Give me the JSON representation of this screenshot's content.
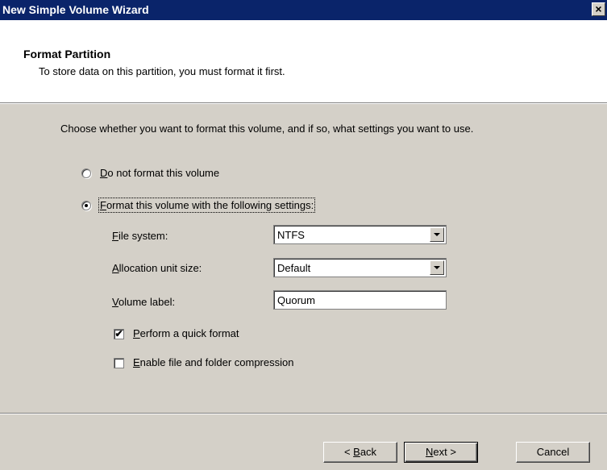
{
  "window": {
    "title": "New Simple Volume Wizard",
    "close_glyph": "×"
  },
  "header": {
    "title": "Format Partition",
    "subtitle": "To store data on this partition, you must format it first."
  },
  "body": {
    "intro": "Choose whether you want to format this volume, and if so, what settings you want to use.",
    "options": {
      "do_not_format": {
        "prefix_underlined": "D",
        "rest": "o not format this volume",
        "selected": false
      },
      "format": {
        "prefix_underlined": "F",
        "rest": "ormat this volume with the following settings:",
        "selected": true
      }
    },
    "file_system": {
      "label_u": "F",
      "label_rest": "ile system:",
      "value": "NTFS"
    },
    "allocation_unit": {
      "label_u": "A",
      "label_rest": "llocation unit size:",
      "value": "Default"
    },
    "volume_label": {
      "label_u": "V",
      "label_rest": "olume label:",
      "value": "Quorum"
    },
    "quick_format": {
      "label_u": "P",
      "label_rest": "erform a quick format",
      "checked": true,
      "mark": "✔"
    },
    "compression": {
      "label_u": "E",
      "label_rest": "nable file and folder compression",
      "checked": false
    }
  },
  "buttons": {
    "back": {
      "prefix": "< ",
      "u": "B",
      "rest": "ack"
    },
    "next": {
      "u": "N",
      "rest": "ext >"
    },
    "cancel": "Cancel"
  }
}
